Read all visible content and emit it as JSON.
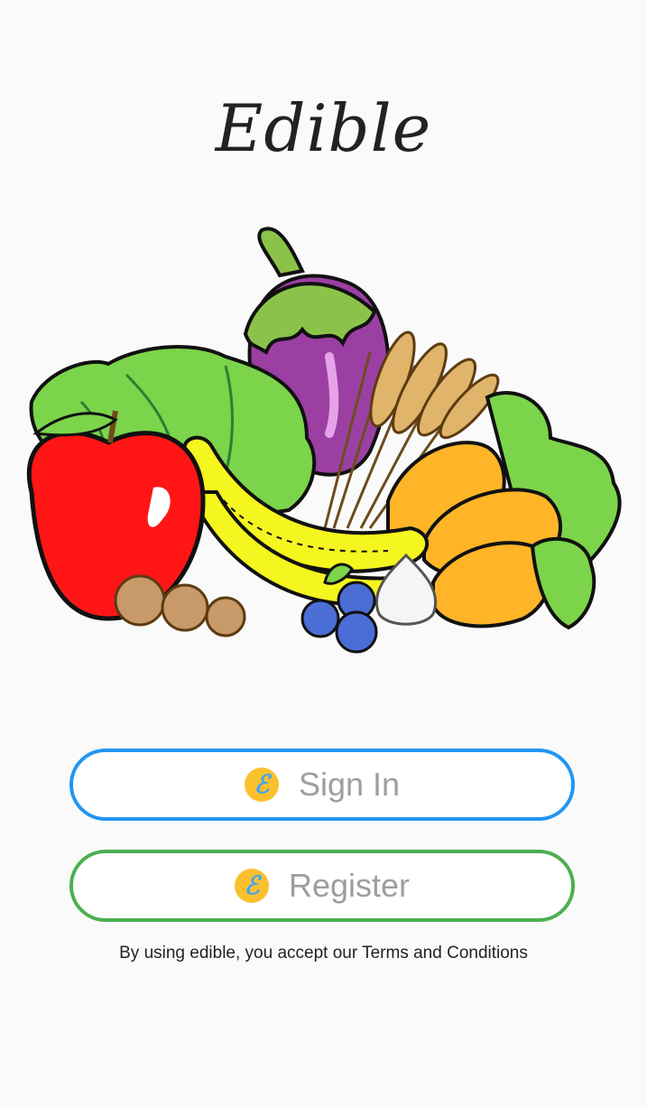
{
  "app": {
    "title": "Edible"
  },
  "buttons": {
    "signin": {
      "label": "Sign In",
      "icon": "edible-logo-icon"
    },
    "register": {
      "label": "Register",
      "icon": "edible-logo-icon"
    }
  },
  "terms": {
    "text": "By using edible, you accept our Terms and Conditions"
  },
  "colors": {
    "background": "#fafafa",
    "signin_border": "#2196f3",
    "register_border": "#4caf50",
    "button_text": "#9e9e9e",
    "logo_badge": "#fbc02d",
    "logo_letter": "#42a5f5"
  }
}
